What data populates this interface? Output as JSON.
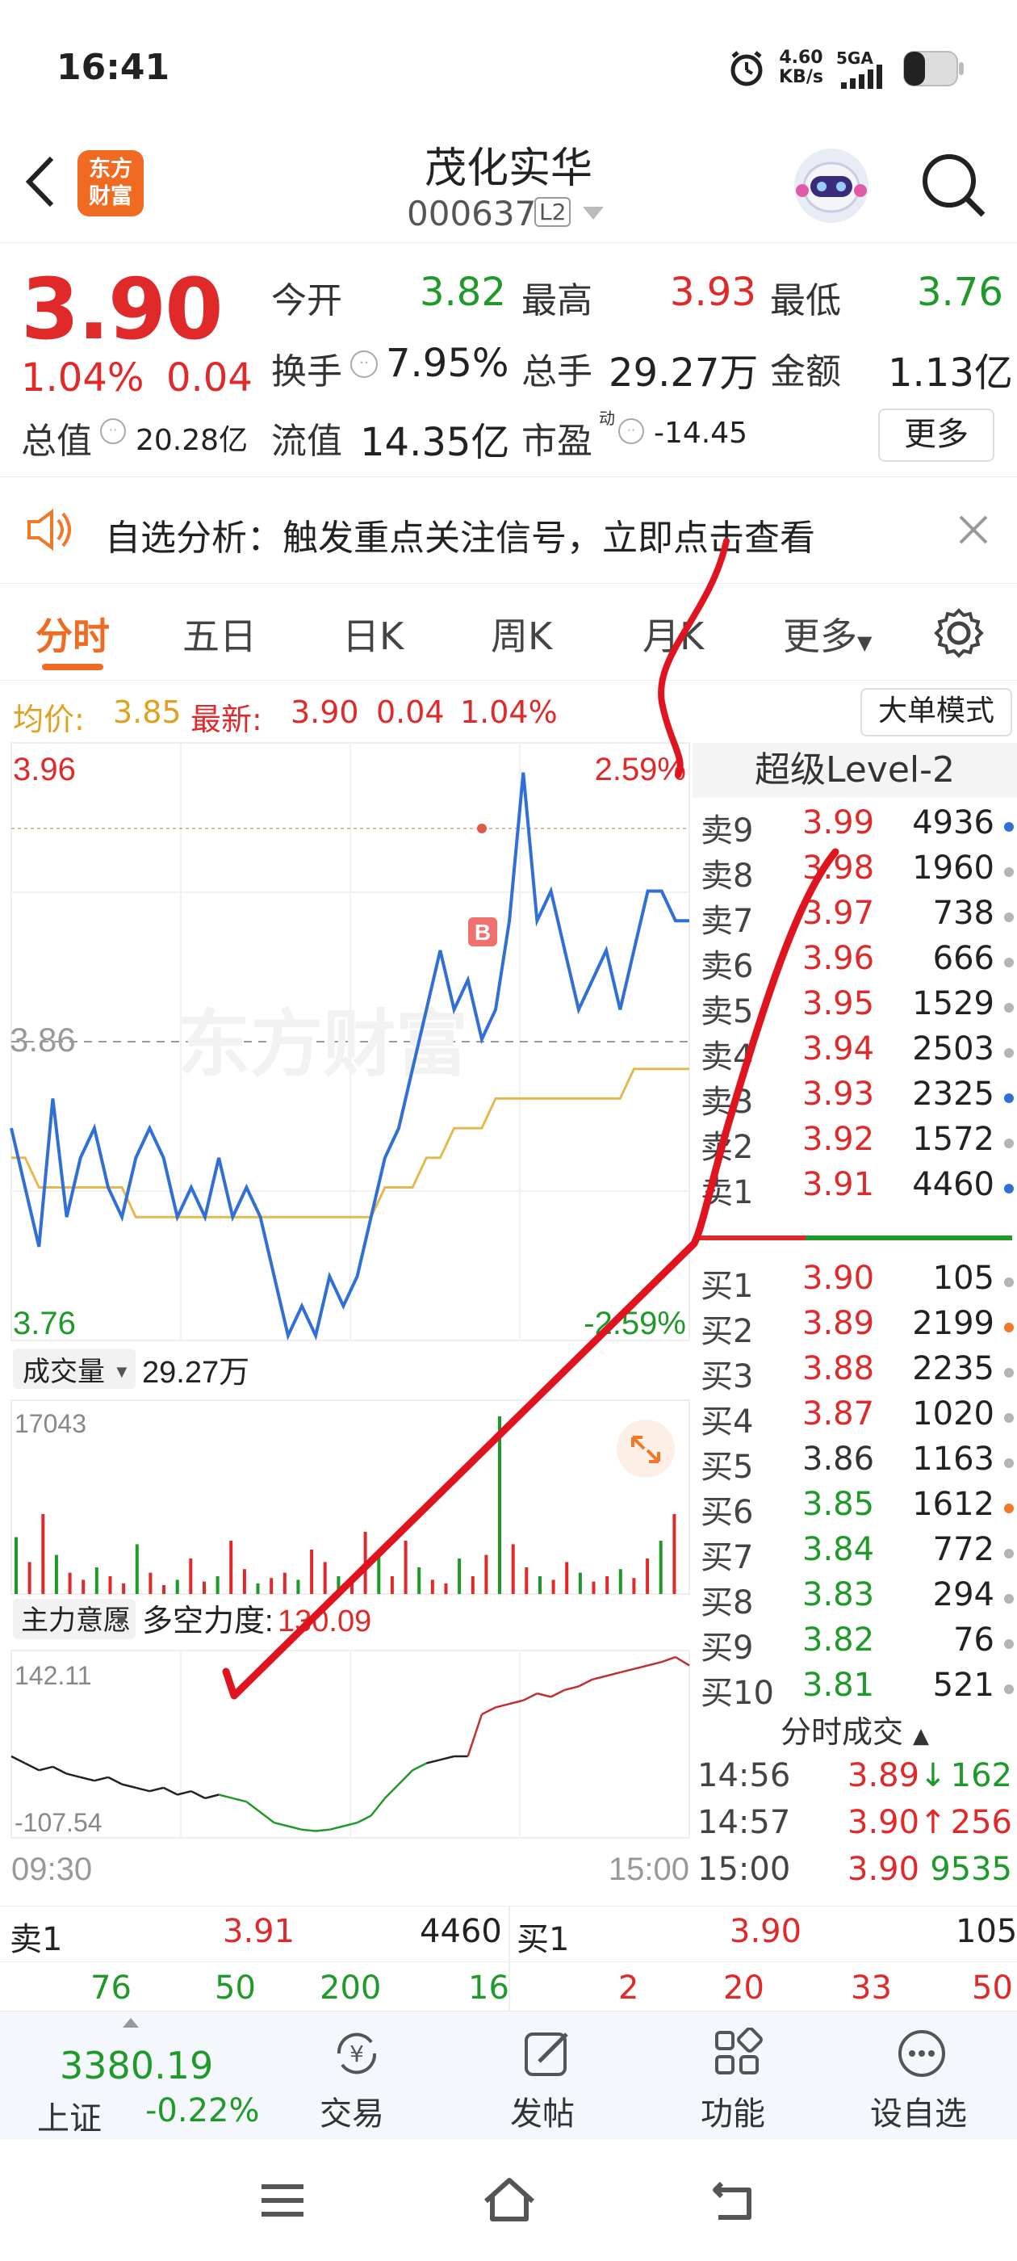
{
  "status": {
    "time": "16:41",
    "net_speed": "4.60",
    "net_unit": "KB/s",
    "signal": "5GA"
  },
  "header": {
    "logo_text": "东方\n财富",
    "title": "茂化实华",
    "code": "000637",
    "level_badge": "L2"
  },
  "quote": {
    "price": "3.90",
    "change_pct": "1.04%",
    "change": "0.04",
    "open_label": "今开",
    "open": "3.82",
    "high_label": "最高",
    "high": "3.93",
    "low_label": "最低",
    "low": "3.76",
    "turnover_label": "换手",
    "turnover": "7.95%",
    "volume_label": "总手",
    "volume": "29.27万",
    "amount_label": "金额",
    "amount": "1.13亿",
    "mktcap_label": "总值",
    "mktcap": "20.28亿",
    "float_label": "流值",
    "float_cap": "14.35亿",
    "pe_label": "市盈",
    "pe_sup": "动",
    "pe": "-14.45",
    "more_button": "更多"
  },
  "notice": {
    "text": "自选分析：触发重点关注信号，立即点击查看"
  },
  "tabs": [
    {
      "label": "分时",
      "active": true
    },
    {
      "label": "五日"
    },
    {
      "label": "日K"
    },
    {
      "label": "周K"
    },
    {
      "label": "月K"
    },
    {
      "label": "更多"
    }
  ],
  "avg_line": {
    "avg_label": "均价:",
    "avg": "3.85",
    "latest_label": "最新:",
    "latest": "3.90",
    "change": "0.04",
    "change_pct": "1.04%",
    "mode_button": "大单模式"
  },
  "price_chart": {
    "y_max": "3.96",
    "y_mid": "3.86",
    "y_min": "3.76",
    "pct_max": "2.59%",
    "pct_min": "-2.59%",
    "watermark": "东方财富",
    "marker": "B"
  },
  "volume_chart": {
    "selector": "成交量",
    "total": "29.27万",
    "max_label": "17043"
  },
  "force_chart": {
    "selector": "主力意愿",
    "power_label": "多空力度:",
    "power": "130.09",
    "max_label": "142.11",
    "min_label": "-107.54",
    "time_start": "09:30",
    "time_end": "15:00"
  },
  "chart_data": [
    {
      "type": "line",
      "title": "",
      "x": [
        "09:30",
        "15:00"
      ],
      "ylim": [
        3.76,
        3.96
      ],
      "series": [
        {
          "name": "",
          "values": [
            3.83,
            3.81,
            3.79,
            3.84,
            3.8,
            3.82,
            3.83,
            3.81,
            3.8,
            3.82,
            3.83,
            3.82,
            3.8,
            3.81,
            3.8,
            3.82,
            3.8,
            3.81,
            3.8,
            3.78,
            3.76,
            3.77,
            3.76,
            3.78,
            3.77,
            3.78,
            3.8,
            3.82,
            3.83,
            3.85,
            3.87,
            3.89,
            3.87,
            3.88,
            3.86,
            3.87,
            3.9,
            3.95,
            3.9,
            3.91,
            3.89,
            3.87,
            3.88,
            3.89,
            3.87,
            3.89,
            3.91,
            3.91,
            3.9,
            3.9
          ]
        },
        {
          "name": "",
          "values": [
            3.82,
            3.82,
            3.81,
            3.81,
            3.81,
            3.81,
            3.81,
            3.81,
            3.81,
            3.8,
            3.8,
            3.8,
            3.8,
            3.8,
            3.8,
            3.8,
            3.8,
            3.8,
            3.8,
            3.8,
            3.8,
            3.8,
            3.8,
            3.8,
            3.8,
            3.8,
            3.8,
            3.81,
            3.81,
            3.81,
            3.82,
            3.82,
            3.83,
            3.83,
            3.83,
            3.84,
            3.84,
            3.84,
            3.84,
            3.84,
            3.84,
            3.84,
            3.84,
            3.84,
            3.84,
            3.85,
            3.85,
            3.85,
            3.85,
            3.85
          ]
        }
      ]
    },
    {
      "type": "bar",
      "title": "",
      "ylim": [
        0,
        17043
      ]
    },
    {
      "type": "line",
      "title": "",
      "ylim": [
        -107.54,
        142.11
      ],
      "series": [
        {
          "name": "",
          "values": [
            0,
            -10,
            -20,
            -15,
            -25,
            -30,
            -35,
            -30,
            -40,
            -45,
            -50,
            -45,
            -55,
            -50,
            -60,
            -55,
            -60,
            -65,
            -80,
            -95,
            -100,
            -105,
            -107,
            -105,
            -100,
            -95,
            -85,
            -60,
            -40,
            -20,
            -10,
            -5,
            0,
            0,
            60,
            70,
            75,
            80,
            90,
            85,
            95,
            100,
            110,
            115,
            120,
            125,
            130,
            135,
            142,
            130
          ]
        }
      ]
    }
  ],
  "orderbook": {
    "title": "超级Level-2",
    "asks": [
      {
        "label": "卖9",
        "price": "3.99",
        "vol": "4936",
        "dot": "#2f6fd6"
      },
      {
        "label": "卖8",
        "price": "3.98",
        "vol": "1960",
        "dot": "#b5b5b5"
      },
      {
        "label": "卖7",
        "price": "3.97",
        "vol": "738",
        "dot": "#b5b5b5"
      },
      {
        "label": "卖6",
        "price": "3.96",
        "vol": "666",
        "dot": "#b5b5b5"
      },
      {
        "label": "卖5",
        "price": "3.95",
        "vol": "1529",
        "dot": "#b5b5b5"
      },
      {
        "label": "卖4",
        "price": "3.94",
        "vol": "2503",
        "dot": "#b5b5b5"
      },
      {
        "label": "卖3",
        "price": "3.93",
        "vol": "2325",
        "dot": "#2f6fd6"
      },
      {
        "label": "卖2",
        "price": "3.92",
        "vol": "1572",
        "dot": "#b5b5b5"
      },
      {
        "label": "卖1",
        "price": "3.91",
        "vol": "4460",
        "dot": "#2f6fd6"
      }
    ],
    "bids": [
      {
        "label": "买1",
        "price": "3.90",
        "vol": "105",
        "dot": "#b5b5b5",
        "pc": "red"
      },
      {
        "label": "买2",
        "price": "3.89",
        "vol": "2199",
        "dot": "#f07828",
        "pc": "red"
      },
      {
        "label": "买3",
        "price": "3.88",
        "vol": "2235",
        "dot": "#b5b5b5",
        "pc": "red"
      },
      {
        "label": "买4",
        "price": "3.87",
        "vol": "1020",
        "dot": "#b5b5b5",
        "pc": "red"
      },
      {
        "label": "买5",
        "price": "3.86",
        "vol": "1163",
        "dot": "#b5b5b5",
        "pc": "dark"
      },
      {
        "label": "买6",
        "price": "3.85",
        "vol": "1612",
        "dot": "#f07828",
        "pc": "green"
      },
      {
        "label": "买7",
        "price": "3.84",
        "vol": "772",
        "dot": "#b5b5b5",
        "pc": "green"
      },
      {
        "label": "买8",
        "price": "3.83",
        "vol": "294",
        "dot": "#b5b5b5",
        "pc": "green"
      },
      {
        "label": "买9",
        "price": "3.82",
        "vol": "76",
        "dot": "#b5b5b5",
        "pc": "green"
      },
      {
        "label": "买10",
        "price": "3.81",
        "vol": "521",
        "dot": "#b5b5b5",
        "pc": "green"
      }
    ],
    "ticks_title": "分时成交",
    "ticks": [
      {
        "time": "14:56",
        "price": "3.89↓",
        "vol": "162"
      },
      {
        "time": "14:57",
        "price": "3.90↑",
        "vol": "256"
      },
      {
        "time": "15:00",
        "price": "3.90",
        "vol": "9535"
      }
    ]
  },
  "bottom_quote": {
    "ask_label": "卖1",
    "ask_price": "3.91",
    "ask_vol": "4460",
    "bid_label": "买1",
    "bid_price": "3.90",
    "bid_vol": "105",
    "ask_queue": [
      "76",
      "50",
      "200",
      "16"
    ],
    "bid_queue": [
      "2",
      "20",
      "33",
      "50"
    ]
  },
  "bottom_nav": {
    "index_value": "3380.19",
    "index_name": "上证",
    "index_change": "-0.22%",
    "items": [
      {
        "label": "交易",
        "icon": "trade-icon"
      },
      {
        "label": "发帖",
        "icon": "edit-icon"
      },
      {
        "label": "功能",
        "icon": "grid-icon"
      },
      {
        "label": "设自选",
        "icon": "more-icon"
      }
    ]
  },
  "colors": {
    "up": "#e02a2a",
    "down": "#1f9a2a",
    "accent": "#f07828",
    "price_line": "#2f6fd6",
    "avg_line": "#e0b040",
    "annotation": "#e0141e"
  }
}
